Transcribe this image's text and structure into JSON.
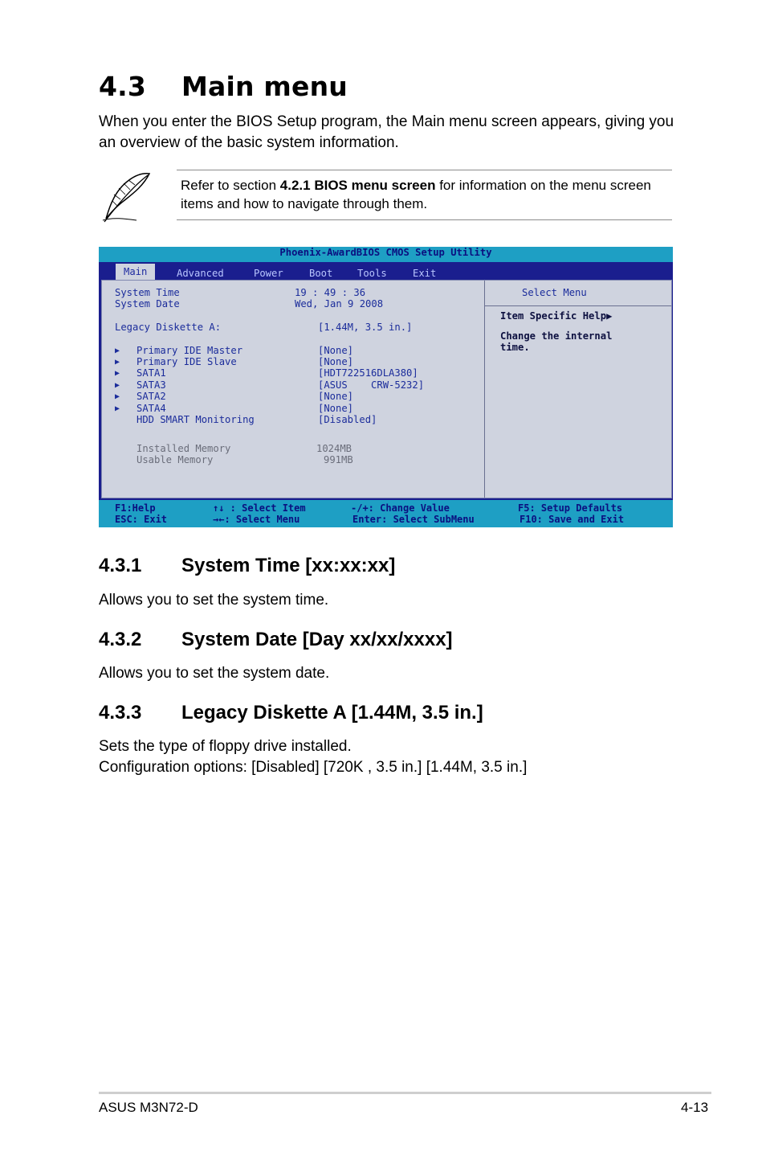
{
  "heading": {
    "number": "4.3",
    "title": "Main menu"
  },
  "intro": "When you enter the BIOS Setup program, the Main menu screen appears, giving you an overview of the basic system information.",
  "note": {
    "icon": "feather-quill-icon",
    "prefix": "Refer to section ",
    "bold": "4.2.1 BIOS menu screen",
    "suffix": " for information on the menu screen items and how to navigate through them."
  },
  "bios": {
    "title": "Phoenix-AwardBIOS CMOS Setup Utility",
    "tabs": [
      "Main",
      "Advanced",
      "Power",
      "Boot",
      "Tools",
      "Exit"
    ],
    "items": {
      "system_time": {
        "label": "System Time",
        "value": "19 : 49 : 36"
      },
      "system_date": {
        "label": "System Date",
        "value": "Wed, Jan 9 2008"
      },
      "legacy_diskette": {
        "label": "Legacy Diskette A:",
        "value": "[1.44M, 3.5 in.]"
      },
      "primary_ide_master": {
        "label": "Primary IDE Master",
        "value": "[None]"
      },
      "primary_ide_slave": {
        "label": "Primary IDE Slave",
        "value": "[None]"
      },
      "sata1": {
        "label": "SATA1",
        "value": "[HDT722516DLA380]"
      },
      "sata3": {
        "label": "SATA3",
        "value": "[ASUS    CRW-5232]"
      },
      "sata2": {
        "label": "SATA2",
        "value": "[None]"
      },
      "sata4": {
        "label": "SATA4",
        "value": "[None]"
      },
      "hdd_smart": {
        "label": "HDD SMART Monitoring",
        "value": "[Disabled]"
      },
      "installed_memory": {
        "label": "Installed Memory",
        "value": "1024MB"
      },
      "usable_memory": {
        "label": "Usable Memory",
        "value": "991MB"
      }
    },
    "help": {
      "header": "Select Menu",
      "item_specific": "Item Specific Help",
      "line1": "Change the internal",
      "line2": "time."
    },
    "footer": {
      "f1": "F1:Help",
      "esc": "ESC: Exit",
      "updown": "↑↓ : Select Item",
      "leftright": "→←: Select Menu",
      "change": "-/+: Change Value",
      "enter": "Enter: Select SubMenu",
      "f5": "F5: Setup Defaults",
      "f10": "F10: Save and Exit"
    }
  },
  "sections": [
    {
      "number": "4.3.1",
      "title": "System Time [xx:xx:xx]",
      "text": "Allows you to set the system time."
    },
    {
      "number": "4.3.2",
      "title": "System Date [Day xx/xx/xxxx]",
      "text": "Allows you to set the system date."
    },
    {
      "number": "4.3.3",
      "title": "Legacy Diskette A [1.44M, 3.5 in.]",
      "text": "Sets the type of floppy drive installed.",
      "text2": "Configuration options: [Disabled] [720K , 3.5 in.] [1.44M, 3.5 in.]"
    }
  ],
  "page_footer": {
    "left": "ASUS M3N72-D",
    "right": "4-13"
  }
}
